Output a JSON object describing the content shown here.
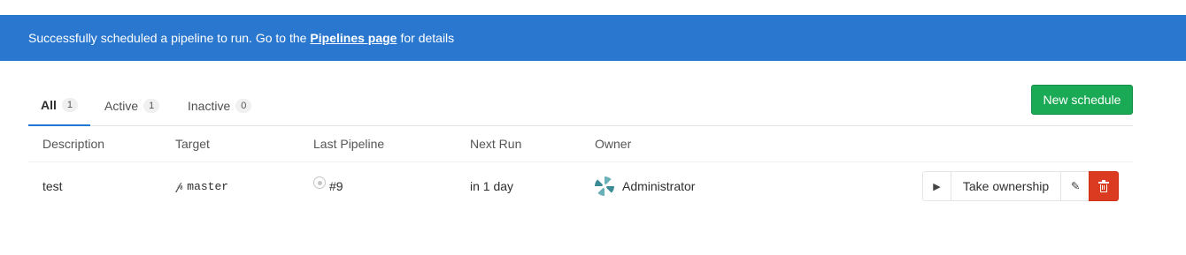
{
  "flash": {
    "text_before": "Successfully scheduled a pipeline to run. Go to the",
    "link_text": "Pipelines page",
    "text_after": "for details",
    "color": "#2a77cf"
  },
  "tabs": [
    {
      "label": "All",
      "count": "1",
      "active": true
    },
    {
      "label": "Active",
      "count": "1",
      "active": false
    },
    {
      "label": "Inactive",
      "count": "0",
      "active": false
    }
  ],
  "new_schedule_label": "New schedule",
  "table": {
    "headers": [
      "Description",
      "Target",
      "Last Pipeline",
      "Next Run",
      "Owner"
    ],
    "rows": [
      {
        "description": "test",
        "target": "master",
        "target_icon": "branch-icon",
        "last_pipeline": "#9",
        "pipeline_status_icon": "status-created-icon",
        "next_run": "in 1 day",
        "owner": "Administrator",
        "actions": {
          "play_icon": "play-icon",
          "take_ownership": "Take ownership",
          "edit_icon": "pencil-icon",
          "delete_icon": "trash-icon"
        }
      }
    ]
  },
  "colors": {
    "accent_blue": "#1f78d1",
    "success_green": "#1aaa55",
    "danger_red": "#db3b21"
  }
}
